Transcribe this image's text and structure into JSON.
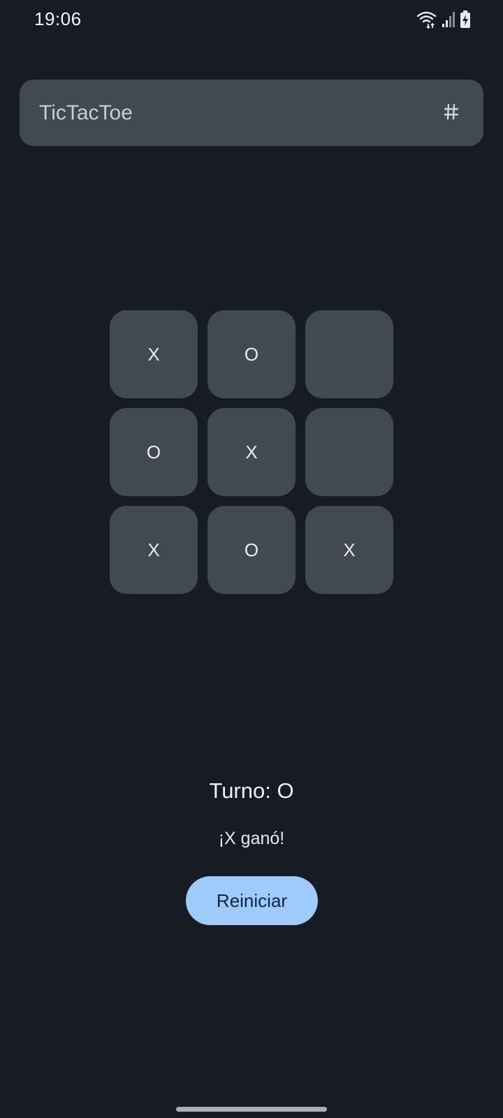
{
  "status_bar": {
    "time": "19:06",
    "icons": [
      "wifi-data-icon",
      "signal-icon",
      "battery-charging-icon"
    ]
  },
  "app_bar": {
    "title": "TicTacToe",
    "action_icon": "hash-icon"
  },
  "board": {
    "cells": [
      "X",
      "O",
      "",
      "O",
      "X",
      "",
      "X",
      "O",
      "X"
    ]
  },
  "turn_text": "Turno: O",
  "result_text": "¡X ganó!",
  "reset_label": "Reiniciar",
  "colors": {
    "background": "#171c24",
    "surface": "#414953",
    "accent": "#9ecbfb",
    "accent_text": "#10253d"
  }
}
